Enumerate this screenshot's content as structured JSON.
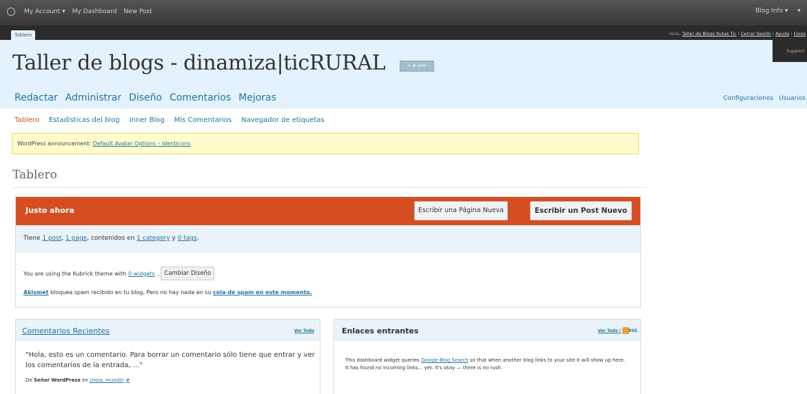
{
  "adminbar": {
    "items": [
      "My Account ▾",
      "My Dashboard",
      "New Post"
    ],
    "right_items": [
      "Blog Info ▾",
      "✦"
    ]
  },
  "tabstrip": {
    "tab_label": "Tablero",
    "howdy": "Hola,",
    "user_link": "Taller de Blogs Rutas Tic",
    "logout": "Cerrar Sesión",
    "help": "Ayuda",
    "forums": "Foros",
    "support": "Support"
  },
  "header": {
    "site_title": "Taller de blogs - dinamiza|ticRURAL",
    "visit_label": "Ir al sitio"
  },
  "mainnav": [
    "Redactar",
    "Administrar",
    "Diseño",
    "Comentarios",
    "Mejoras"
  ],
  "rightnav": [
    "Configuraciones",
    "Usuarios"
  ],
  "subnav": [
    "Tablero",
    "Estadísticas del blog",
    "Inner Blog",
    "Mis Comentarios",
    "Navegador de etiquetas"
  ],
  "notice": {
    "prefix": "WordPress announcement:",
    "link": "Default Avatar Options – Identicons"
  },
  "page_title": "Tablero",
  "rightnow": {
    "title": "Justo ahora",
    "btn_page": "Escribir una Página Nueva",
    "btn_post": "Escribir un Post Nuevo",
    "stats_prefix": "Tiene",
    "posts": "1 post",
    "sep1": ",",
    "pages": "1 page",
    "stats_mid": ", contenidos en",
    "categories": "1 category",
    "and": "y",
    "tags": "0 tags",
    "period": ".",
    "theme_text": "You are using the Kubrick theme with",
    "widgets": "0 widgets",
    "theme_end": ".",
    "change_theme": "Cambiar Diseño",
    "akismet": "Akismet",
    "akismet_text": "bloquea spam recibido en tu blog, Pero no hay nada en su",
    "spam_link": "cola de spam en este momento."
  },
  "recent_comments": {
    "title": "Comentarios Recientes",
    "view_all": "Ver Todo",
    "comment": "\"Hola, esto es un comentario. Para borrar un comentario sólo tiene que entrar y ver los comentarios de la entrada, ...\"",
    "by": "De",
    "author": "Señor WordPress",
    "on": "en",
    "post_link": "¡Hola, mundo!",
    "hash": "#"
  },
  "incoming_links": {
    "title": "Enlaces entrantes",
    "view_all": "Ver Todo",
    "pipe": "|",
    "rss": "RSS",
    "text_before": "This dashboard widget queries",
    "search_link": "Google Blog Search",
    "text_after": "so that when another blog links to your site it will show up here. It has found no incoming links… yet. It's okay — there is no rush."
  }
}
